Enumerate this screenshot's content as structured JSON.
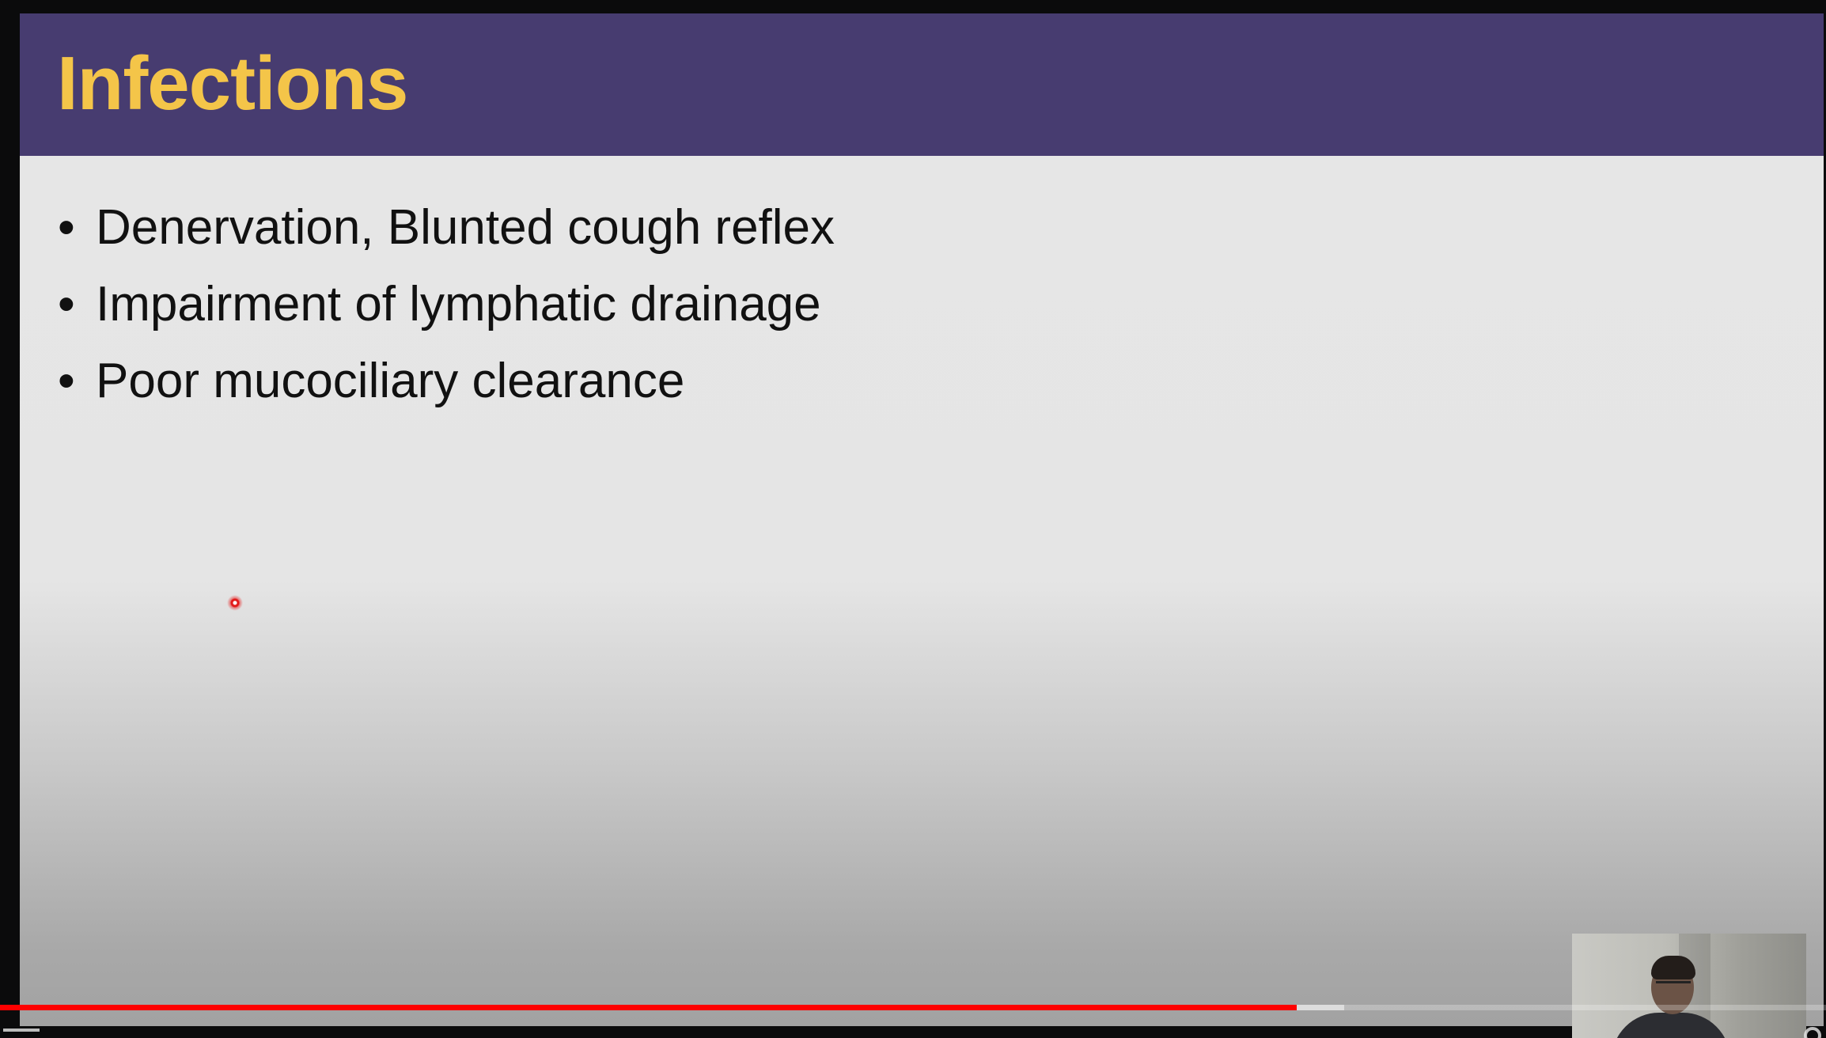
{
  "slide": {
    "title": "Infections",
    "header_color": "#473c70",
    "title_color": "#f4c549",
    "bullets": [
      "Denervation, Blunted cough reflex",
      "Impairment of lymphatic drainage",
      "Poor mucociliary clearance"
    ],
    "bullet_glyph": "•"
  },
  "player": {
    "progress_played_fraction": 0.71,
    "progress_buffered_fraction": 0.736,
    "played_color": "#ff0000"
  },
  "icons": {
    "laser_pointer": "laser-pointer-dot",
    "left_control": "play-icon",
    "right_control": "settings-icon"
  }
}
